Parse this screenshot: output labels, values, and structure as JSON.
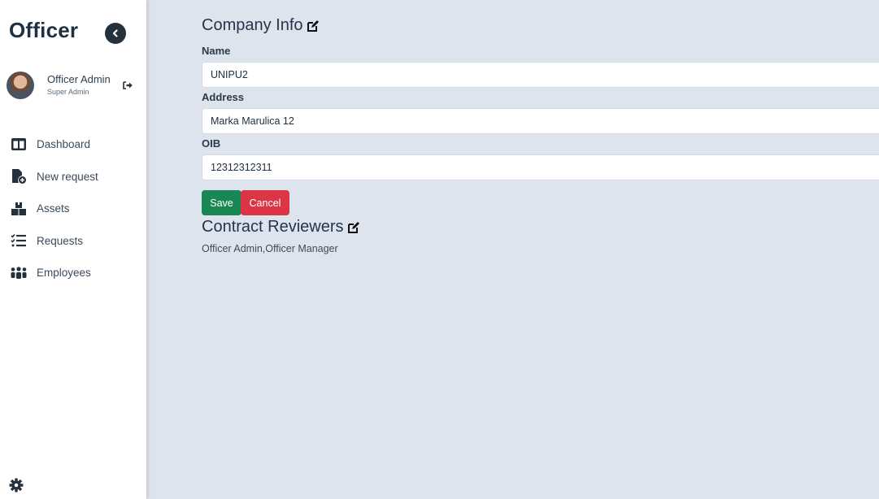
{
  "sidebar": {
    "brand": "Officer",
    "user": {
      "name": "Officer Admin",
      "role": "Super Admin"
    },
    "nav": [
      {
        "label": "Dashboard",
        "icon": "dashboard-icon"
      },
      {
        "label": "New request",
        "icon": "new-request-icon"
      },
      {
        "label": "Assets",
        "icon": "assets-icon"
      },
      {
        "label": "Requests",
        "icon": "requests-icon"
      },
      {
        "label": "Employees",
        "icon": "employees-icon"
      }
    ]
  },
  "company_info": {
    "title": "Company Info",
    "fields": {
      "name": {
        "label": "Name",
        "value": "UNIPU2"
      },
      "address": {
        "label": "Address",
        "value": "Marka Marulica 12"
      },
      "oib": {
        "label": "OIB",
        "value": "12312312311"
      }
    },
    "save_label": "Save",
    "cancel_label": "Cancel"
  },
  "contract_reviewers": {
    "title": "Contract Reviewers",
    "value": "Officer Admin,Officer Manager"
  },
  "colors": {
    "accent_dark": "#1e3044",
    "save": "#198754",
    "cancel": "#dc3545",
    "background": "#dde4ee"
  }
}
